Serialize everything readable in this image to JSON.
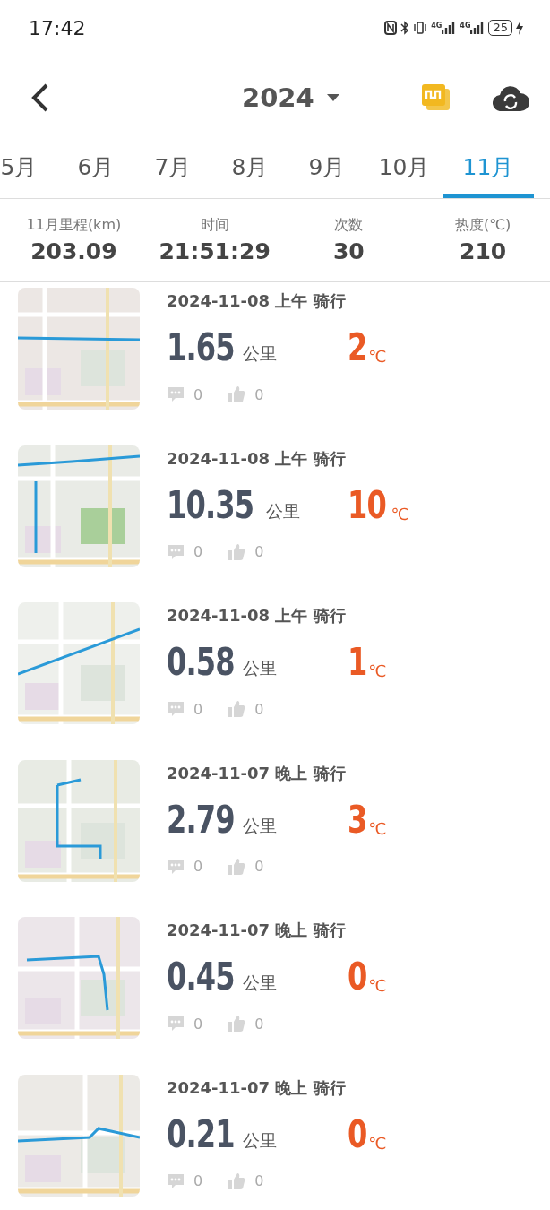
{
  "status_bar": {
    "time": "17:42",
    "signal_labels": [
      "4G",
      "4G"
    ],
    "battery": "25"
  },
  "header": {
    "year": "2024"
  },
  "tabs": [
    {
      "label": "5月",
      "selected": false
    },
    {
      "label": "6月",
      "selected": false
    },
    {
      "label": "7月",
      "selected": false
    },
    {
      "label": "8月",
      "selected": false
    },
    {
      "label": "9月",
      "selected": false
    },
    {
      "label": "10月",
      "selected": false
    },
    {
      "label": "11月",
      "selected": true
    }
  ],
  "summary": [
    {
      "label": "11月里程(km)",
      "value": "203.09"
    },
    {
      "label": "时间",
      "value": "21:51:29"
    },
    {
      "label": "次数",
      "value": "30"
    },
    {
      "label": "热度(℃)",
      "value": "210"
    }
  ],
  "rides": [
    {
      "title": "2024-11-08 上午 骑行",
      "distance": "1.65",
      "unit": "公里",
      "heat": "2",
      "heat_unit": "℃",
      "comments": "0",
      "likes": "0"
    },
    {
      "title": "2024-11-08 上午 骑行",
      "distance": "10.35",
      "unit": "公里",
      "heat": "10",
      "heat_unit": "℃",
      "comments": "0",
      "likes": "0"
    },
    {
      "title": "2024-11-08 上午 骑行",
      "distance": "0.58",
      "unit": "公里",
      "heat": "1",
      "heat_unit": "℃",
      "comments": "0",
      "likes": "0"
    },
    {
      "title": "2024-11-07 晚上 骑行",
      "distance": "2.79",
      "unit": "公里",
      "heat": "3",
      "heat_unit": "℃",
      "comments": "0",
      "likes": "0"
    },
    {
      "title": "2024-11-07 晚上 骑行",
      "distance": "0.45",
      "unit": "公里",
      "heat": "0",
      "heat_unit": "℃",
      "comments": "0",
      "likes": "0"
    },
    {
      "title": "2024-11-07 晚上 骑行",
      "distance": "0.21",
      "unit": "公里",
      "heat": "0",
      "heat_unit": "℃",
      "comments": "0",
      "likes": "0"
    }
  ]
}
